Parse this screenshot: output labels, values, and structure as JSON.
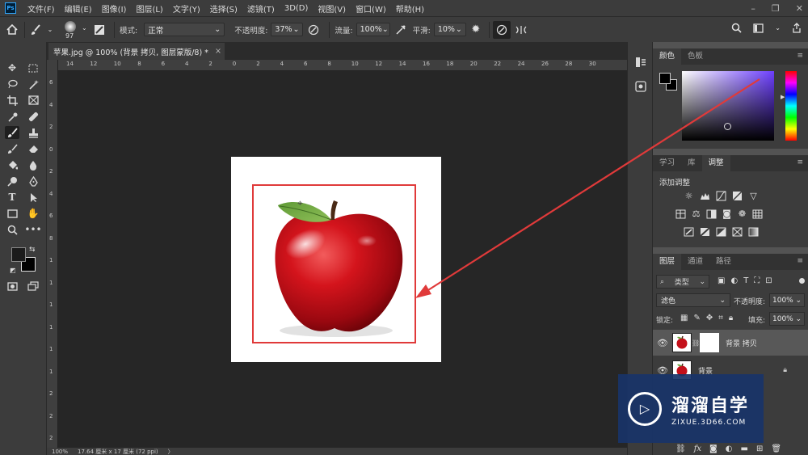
{
  "app": {
    "logo": "Ps"
  },
  "menu": [
    "文件(F)",
    "编辑(E)",
    "图像(I)",
    "图层(L)",
    "文字(Y)",
    "选择(S)",
    "滤镜(T)",
    "3D(D)",
    "视图(V)",
    "窗口(W)",
    "帮助(H)"
  ],
  "window_controls": {
    "minimize": "–",
    "restore": "❐",
    "close": "✕"
  },
  "options": {
    "brush_size": "97",
    "mode_label": "模式:",
    "mode_value": "正常",
    "opacity_label": "不透明度:",
    "opacity_value": "37%",
    "flow_label": "流量:",
    "flow_value": "100%",
    "smoothing_label": "平滑:",
    "smoothing_value": "10%"
  },
  "document_tab": {
    "title": "苹果.jpg @ 100% (背景 拷贝, 图层蒙版/8) *",
    "close": "×"
  },
  "ruler_top_labels": [
    "14",
    "12",
    "10",
    "8",
    "6",
    "4",
    "2",
    "0",
    "2",
    "4",
    "6",
    "8",
    "10",
    "12",
    "14",
    "16",
    "18",
    "20",
    "22",
    "24",
    "26",
    "28",
    "30"
  ],
  "ruler_left_labels": [
    "6",
    "4",
    "2",
    "0",
    "2",
    "4",
    "6",
    "8",
    "1",
    "1",
    "1",
    "1",
    "1",
    "1",
    "2",
    "2",
    "2"
  ],
  "status": {
    "zoom": "100%",
    "doc_info": "17.64 厘米 x 17 厘米 (72 ppi)",
    "arrow": "〉"
  },
  "color_panel": {
    "tabs": [
      "颜色",
      "色板"
    ],
    "active": 0,
    "fg_color": "#000000",
    "bg_color": "#ffffff"
  },
  "adjust_panel": {
    "tabs": [
      "学习",
      "库",
      "调整"
    ],
    "active": 2,
    "add_label": "添加调整"
  },
  "layers_panel": {
    "tabs": [
      "图层",
      "通道",
      "路径"
    ],
    "active": 0,
    "filter_kind": "类型",
    "blend_mode": "滤色",
    "opacity_label": "不透明度:",
    "opacity_value": "100%",
    "lock_label": "锁定:",
    "fill_label": "填充:",
    "fill_value": "100%",
    "layers": [
      {
        "name": "背景 拷贝",
        "has_mask": true,
        "selected": true
      },
      {
        "name": "背景",
        "has_mask": false,
        "selected": false,
        "locked": true
      }
    ]
  },
  "watermark": {
    "cn": "溜溜自学",
    "url": "ZIXUE.3D66.COM"
  },
  "colors": {
    "annotation_red": "#e03a3a",
    "panel_bg": "#3c3c3c",
    "canvas_bg": "#262626"
  }
}
